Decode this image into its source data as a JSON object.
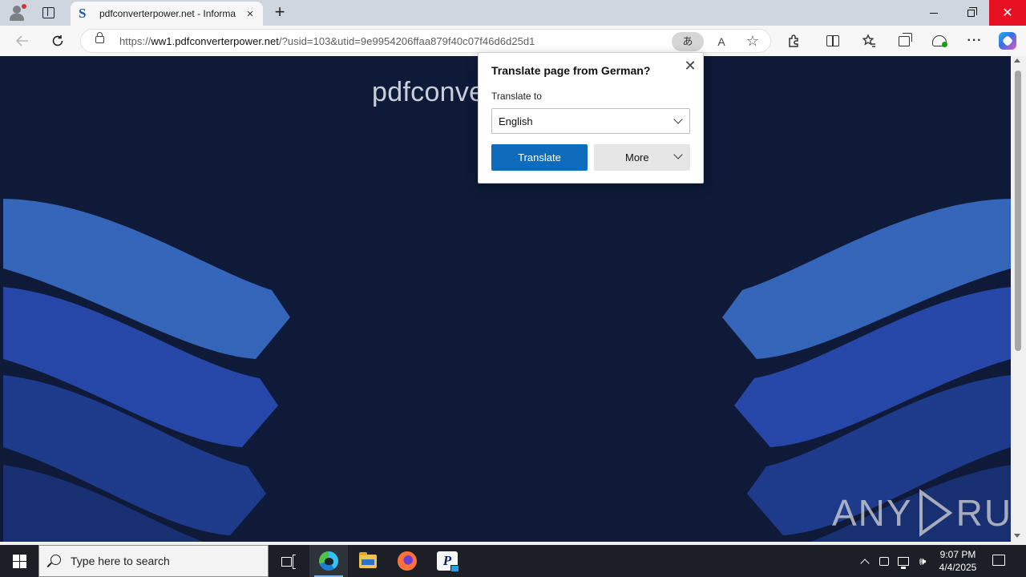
{
  "browser": {
    "tab": {
      "favicon": "S",
      "title": "pdfconverterpower.net - Informa",
      "close_icon": "×"
    },
    "new_tab_label": "+",
    "window": {
      "close_glyph": "✕"
    },
    "address": {
      "url_prefix": "https://",
      "url_host": "ww1.pdfconverterpower.net",
      "url_path": "/?usid=103&utid=9e9954206ffaa879f40c07f46d6d25d1",
      "translate_badge": "あ",
      "read_aloud_glyph": "A",
      "favorite_glyph": "☆"
    },
    "toolbar": {
      "more_glyph": "···",
      "favorites_glyph": "✰",
      "extensions_glyph": "⧉"
    }
  },
  "page": {
    "site_logo_text": "pdfconve",
    "watermark": {
      "left": "ANY",
      "right": "RUN"
    },
    "colors": {
      "background": "#0e1a38",
      "wave_light": "#3565b8",
      "wave_mid": "#2747a8",
      "wave_dark": "#1e3a8a"
    }
  },
  "translate_popup": {
    "title": "Translate page from German?",
    "label": "Translate to",
    "selected_language": "English",
    "translate_button": "Translate",
    "more_button": "More",
    "close_glyph": "✕"
  },
  "taskbar": {
    "search_placeholder": "Type here to search",
    "apps": [
      "task-view",
      "microsoft-edge",
      "file-explorer",
      "firefox",
      "pdf-app"
    ],
    "clock_time": "9:07 PM",
    "clock_date": "4/4/2025",
    "volume_glyph": "🕪"
  }
}
